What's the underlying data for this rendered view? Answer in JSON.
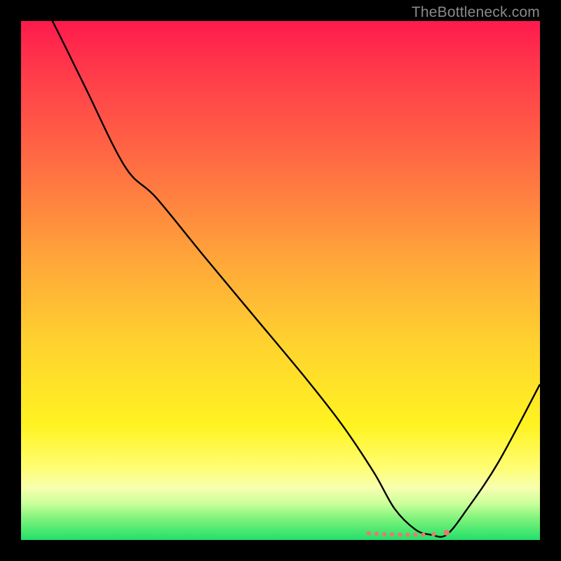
{
  "watermark": "TheBottleneck.com",
  "colors": {
    "black": "#000000",
    "curve": "#000000",
    "dots": "#e77a6e"
  },
  "chart_data": {
    "type": "line",
    "title": "",
    "xlabel": "",
    "ylabel": "",
    "xlim": [
      0,
      100
    ],
    "ylim": [
      0,
      100
    ],
    "series": [
      {
        "name": "bottleneck-curve",
        "x": [
          0,
          5,
          12,
          20,
          26,
          35,
          45,
          55,
          62,
          68,
          72,
          76,
          79,
          82,
          86,
          92,
          100
        ],
        "y": [
          110,
          102,
          88,
          72,
          66,
          55,
          43,
          31,
          22,
          13,
          6,
          2,
          1,
          1,
          6,
          15,
          30
        ]
      }
    ],
    "markers": {
      "name": "highlight-dots",
      "x": [
        67,
        68.5,
        70,
        71.5,
        73,
        74.5,
        76,
        77.5,
        79.5,
        82
      ],
      "y": [
        1.3,
        1.2,
        1.1,
        1.1,
        1.0,
        1.0,
        1.0,
        1.0,
        1.1,
        1.4
      ]
    }
  }
}
